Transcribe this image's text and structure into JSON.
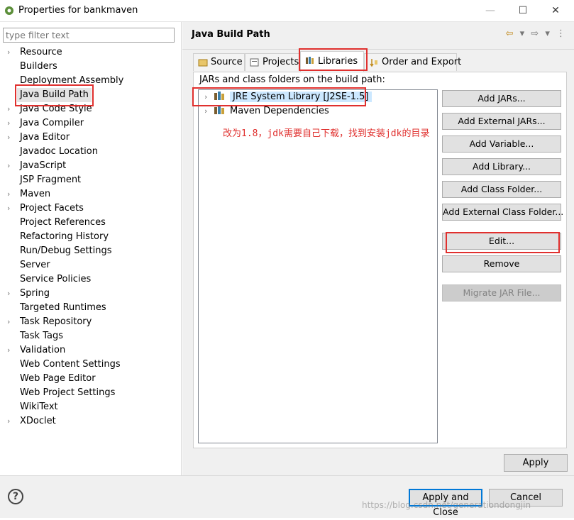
{
  "window": {
    "title": "Properties for bankmaven",
    "minimize": "—",
    "maximize": "☐",
    "close": "✕",
    "icon": "eclipse-gear-icon"
  },
  "left": {
    "filter_placeholder": "type filter text",
    "items": [
      {
        "label": "Resource",
        "expandable": true
      },
      {
        "label": "Builders",
        "expandable": false
      },
      {
        "label": "Deployment Assembly",
        "expandable": false
      },
      {
        "label": "Java Build Path",
        "expandable": false,
        "selected": true
      },
      {
        "label": "Java Code Style",
        "expandable": true
      },
      {
        "label": "Java Compiler",
        "expandable": true
      },
      {
        "label": "Java Editor",
        "expandable": true
      },
      {
        "label": "Javadoc Location",
        "expandable": false
      },
      {
        "label": "JavaScript",
        "expandable": true
      },
      {
        "label": "JSP Fragment",
        "expandable": false
      },
      {
        "label": "Maven",
        "expandable": true
      },
      {
        "label": "Project Facets",
        "expandable": true
      },
      {
        "label": "Project References",
        "expandable": false
      },
      {
        "label": "Refactoring History",
        "expandable": false
      },
      {
        "label": "Run/Debug Settings",
        "expandable": false
      },
      {
        "label": "Server",
        "expandable": false
      },
      {
        "label": "Service Policies",
        "expandable": false
      },
      {
        "label": "Spring",
        "expandable": true
      },
      {
        "label": "Targeted Runtimes",
        "expandable": false
      },
      {
        "label": "Task Repository",
        "expandable": true
      },
      {
        "label": "Task Tags",
        "expandable": false
      },
      {
        "label": "Validation",
        "expandable": true
      },
      {
        "label": "Web Content Settings",
        "expandable": false
      },
      {
        "label": "Web Page Editor",
        "expandable": false
      },
      {
        "label": "Web Project Settings",
        "expandable": false
      },
      {
        "label": "WikiText",
        "expandable": false
      },
      {
        "label": "XDoclet",
        "expandable": true
      }
    ]
  },
  "right": {
    "title": "Java Build Path",
    "nav": {
      "back": "⇦",
      "back_menu": "▾",
      "forward": "⇨",
      "forward_menu": "▾",
      "menu": "⋮"
    },
    "tabs": [
      {
        "label": "Source",
        "icon": "source-folder-icon"
      },
      {
        "label": "Projects",
        "icon": "projects-icon"
      },
      {
        "label": "Libraries",
        "icon": "libraries-icon",
        "active": true
      },
      {
        "label": "Order and Export",
        "icon": "order-export-icon"
      }
    ],
    "jar_label": "JARs and class folders on the build path:",
    "entries": [
      {
        "label": "JRE System Library [J2SE-1.5]",
        "selected": true
      },
      {
        "label": "Maven Dependencies",
        "selected": false
      }
    ],
    "annotation": "改为1.8，jdk需要自己下载，找到安装jdk的目录",
    "buttons": {
      "add_jars": "Add JARs...",
      "add_external_jars": "Add External JARs...",
      "add_variable": "Add Variable...",
      "add_library": "Add Library...",
      "add_class_folder": "Add Class Folder...",
      "add_external_class_folder": "Add External Class Folder...",
      "edit": "Edit...",
      "remove": "Remove",
      "migrate_jar": "Migrate JAR File..."
    },
    "apply": "Apply"
  },
  "bottom": {
    "help": "?",
    "apply_close": "Apply and Close",
    "cancel": "Cancel",
    "watermark": "https://blog.csdn.net/generationdongjin"
  },
  "colors": {
    "annotation_red": "#e0302e",
    "selection_blue": "#cce8ff",
    "focus_blue": "#0078d7"
  }
}
